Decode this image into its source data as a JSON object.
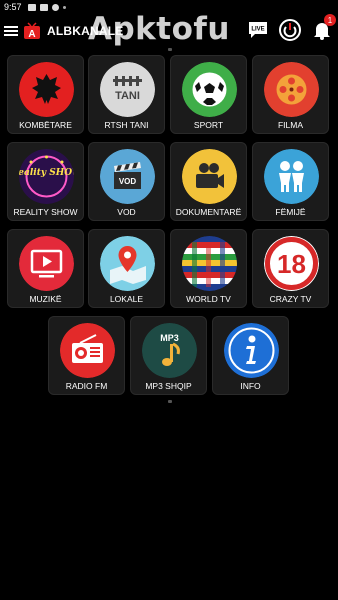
{
  "status": {
    "time": "9:57"
  },
  "appbar": {
    "title": "ALBKANALE",
    "watermark": "Apktofu",
    "live_label": "LIVE",
    "notification_count": "1"
  },
  "tiles": [
    {
      "label": "KOMBËTARE",
      "icon": "albania-flag-icon"
    },
    {
      "label": "RTSH TANI",
      "icon": "rtsh-logo-icon"
    },
    {
      "label": "SPORT",
      "icon": "soccer-ball-icon"
    },
    {
      "label": "FILMA",
      "icon": "film-reel-icon"
    },
    {
      "label": "REALITY SHOW",
      "icon": "reality-show-icon"
    },
    {
      "label": "VOD",
      "icon": "clapperboard-icon"
    },
    {
      "label": "DOKUMENTARË",
      "icon": "movie-camera-icon"
    },
    {
      "label": "FËMIJË",
      "icon": "children-icon"
    },
    {
      "label": "MUZIKË",
      "icon": "tv-play-icon"
    },
    {
      "label": "LOKALE",
      "icon": "map-pin-icon"
    },
    {
      "label": "WORLD TV",
      "icon": "flags-globe-icon"
    },
    {
      "label": "CRAZY TV",
      "icon": "eighteen-plus-icon"
    },
    {
      "label": "RADIO FM",
      "icon": "radio-icon"
    },
    {
      "label": "MP3 SHQIP",
      "icon": "music-note-icon"
    },
    {
      "label": "INFO",
      "icon": "info-icon"
    }
  ],
  "reality_text": "Reality SHOW",
  "tani_text": "TANI",
  "vod_text": "VOD",
  "mp3_text": "MP3",
  "crazy_text": "18"
}
